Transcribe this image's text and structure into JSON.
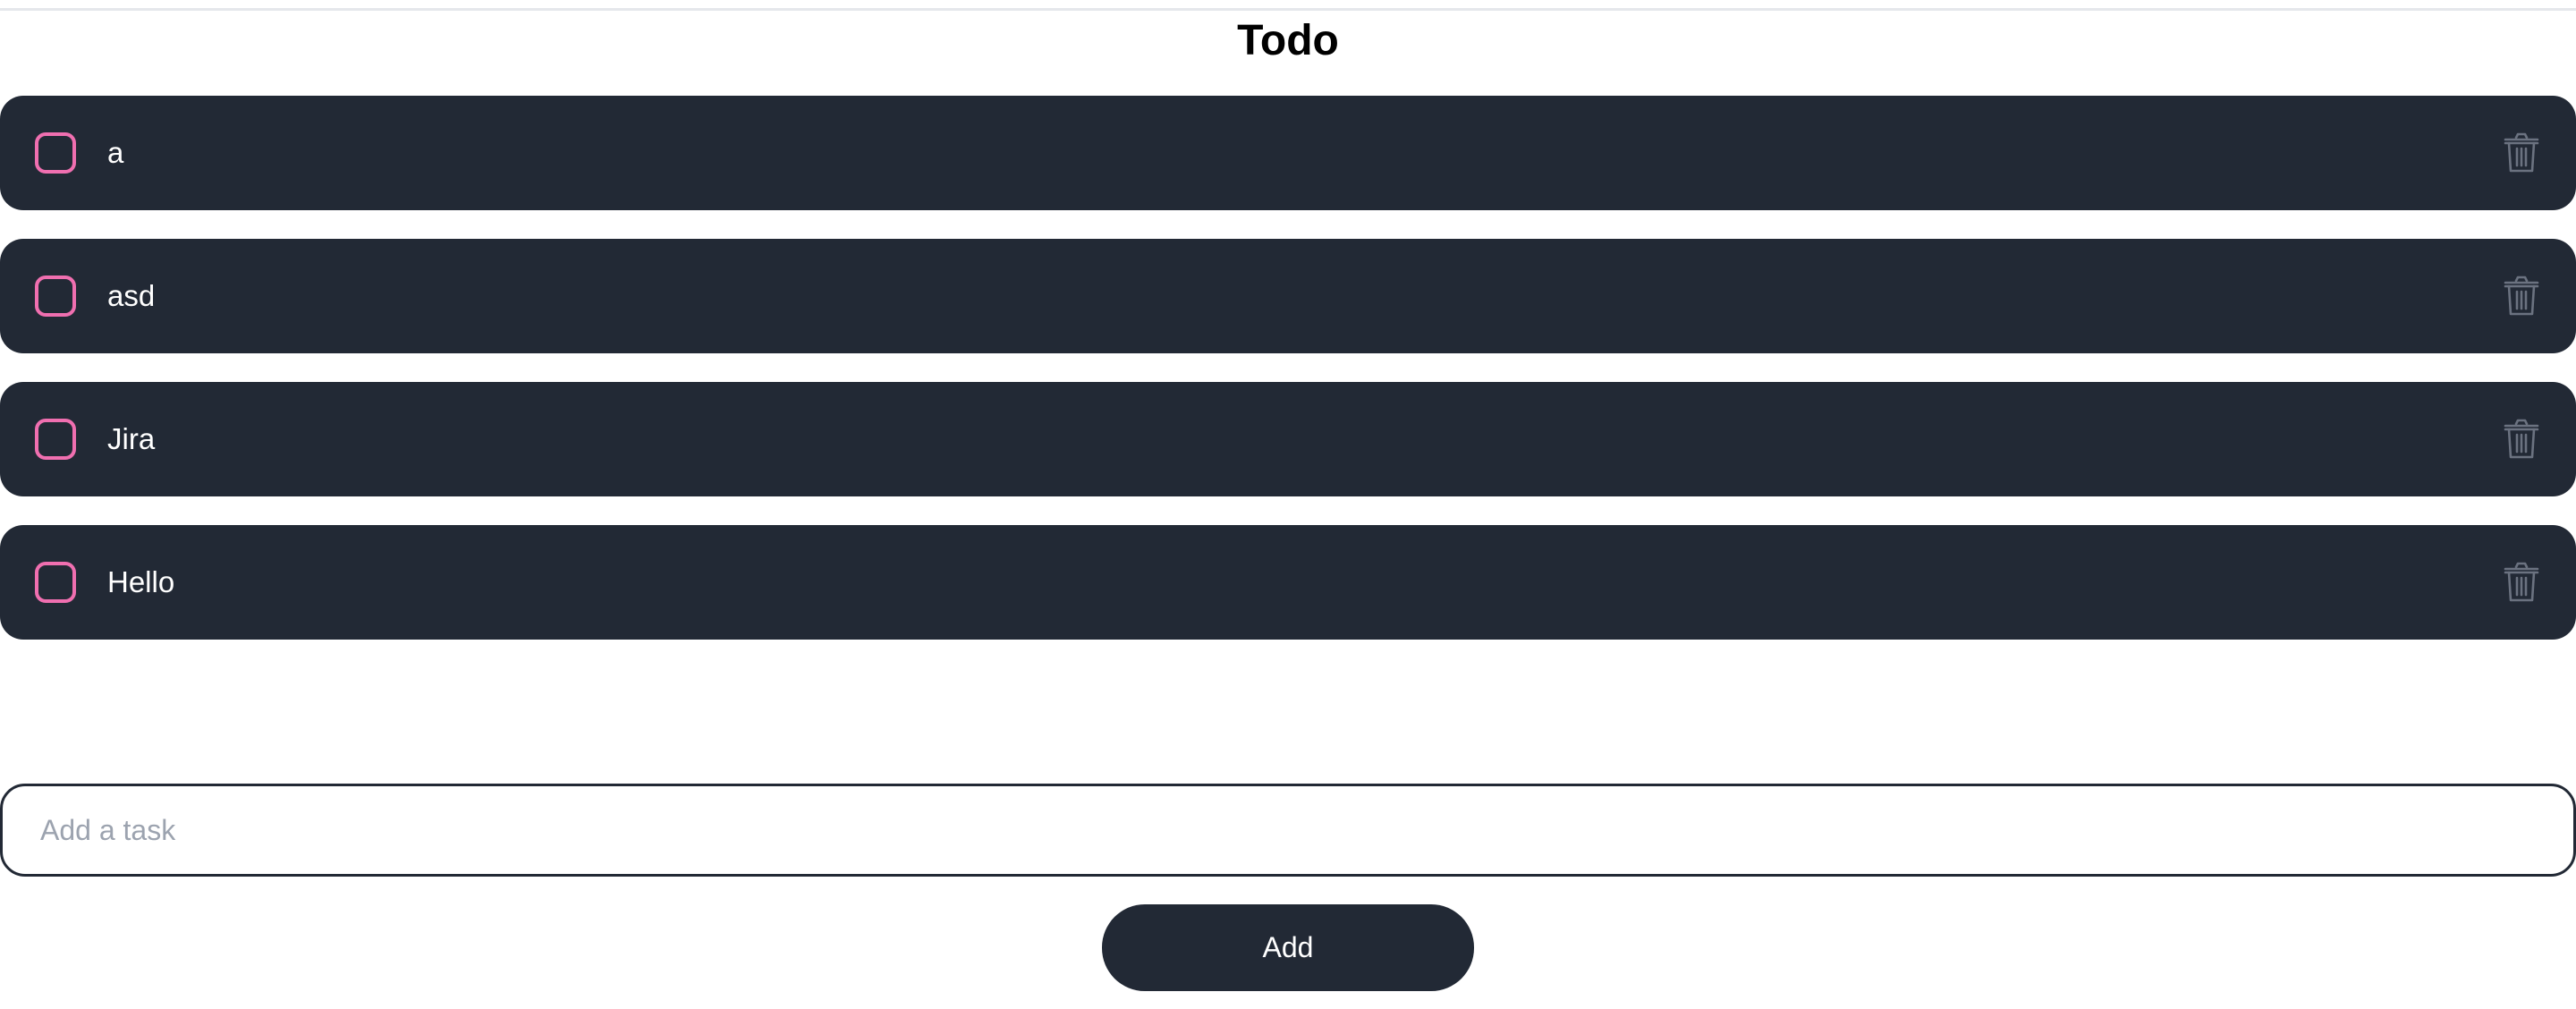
{
  "header": {
    "title": "Todo"
  },
  "todos": [
    {
      "text": "a",
      "completed": false
    },
    {
      "text": "asd",
      "completed": false
    },
    {
      "text": "Jira",
      "completed": false
    },
    {
      "text": "Hello",
      "completed": false
    }
  ],
  "input": {
    "value": "",
    "placeholder": "Add a task"
  },
  "add_button": {
    "label": "Add"
  },
  "colors": {
    "item_background": "#222935",
    "checkbox_border": "#f06fb0",
    "trash_icon": "#6b7280",
    "divider": "#e5e7eb"
  },
  "icons": {
    "delete": "trash-icon"
  }
}
